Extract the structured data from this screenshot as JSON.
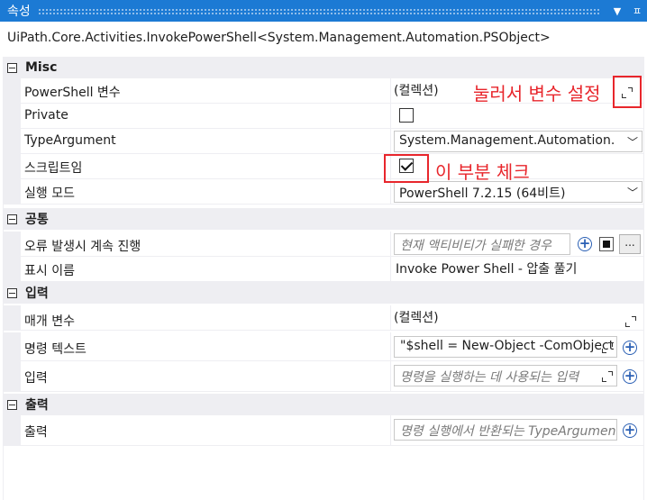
{
  "panel": {
    "title": "속성",
    "pin_glyph": "ᵖ",
    "dropdown_glyph": "▾"
  },
  "class_name": "UiPath.Core.Activities.InvokePowerShell<System.Management.Automation.PSObject>",
  "categories": {
    "misc": "Misc",
    "common": "공통",
    "input": "입력",
    "output": "출력"
  },
  "props": {
    "powershell_var": {
      "name": "PowerShell 변수",
      "value": "(컬렉션)"
    },
    "private": {
      "name": "Private"
    },
    "type_argument": {
      "name": "TypeArgument",
      "value": "System.Management.Automation.PSObject"
    },
    "script": {
      "name": "스크립트임"
    },
    "exec_mode": {
      "name": "실행 모드",
      "value": "PowerShell 7.2.15 (64비트)"
    },
    "continue_on_error": {
      "name": "오류 발생시 계속 진행",
      "placeholder": "현재 액티비티가 실패한 경우"
    },
    "display_name": {
      "name": "표시 이름",
      "value": "Invoke Power Shell - 압출 풀기"
    },
    "params": {
      "name": "매개 변수",
      "value": "(컬렉션)"
    },
    "command_text": {
      "name": "명령 텍스트",
      "value": "\"$shell = New-Object -ComObject"
    },
    "input": {
      "name": "입력",
      "placeholder": "명령을 실행하는 데 사용되는 입력"
    },
    "output": {
      "name": "출력",
      "placeholder": "명령 실행에서 반환되는 TypeArgument"
    }
  },
  "states": {
    "private_checked": false,
    "script_checked": true
  },
  "annotations": {
    "click_to_set": "눌러서 변수 설정",
    "check_here": "이 부분 체크"
  },
  "more_label": "...",
  "colors": {
    "title_bar": "#1c7ad4",
    "category_bg": "#eeeef2",
    "annotation": "#e8262c",
    "plus_icon": "#2a5fb4"
  }
}
